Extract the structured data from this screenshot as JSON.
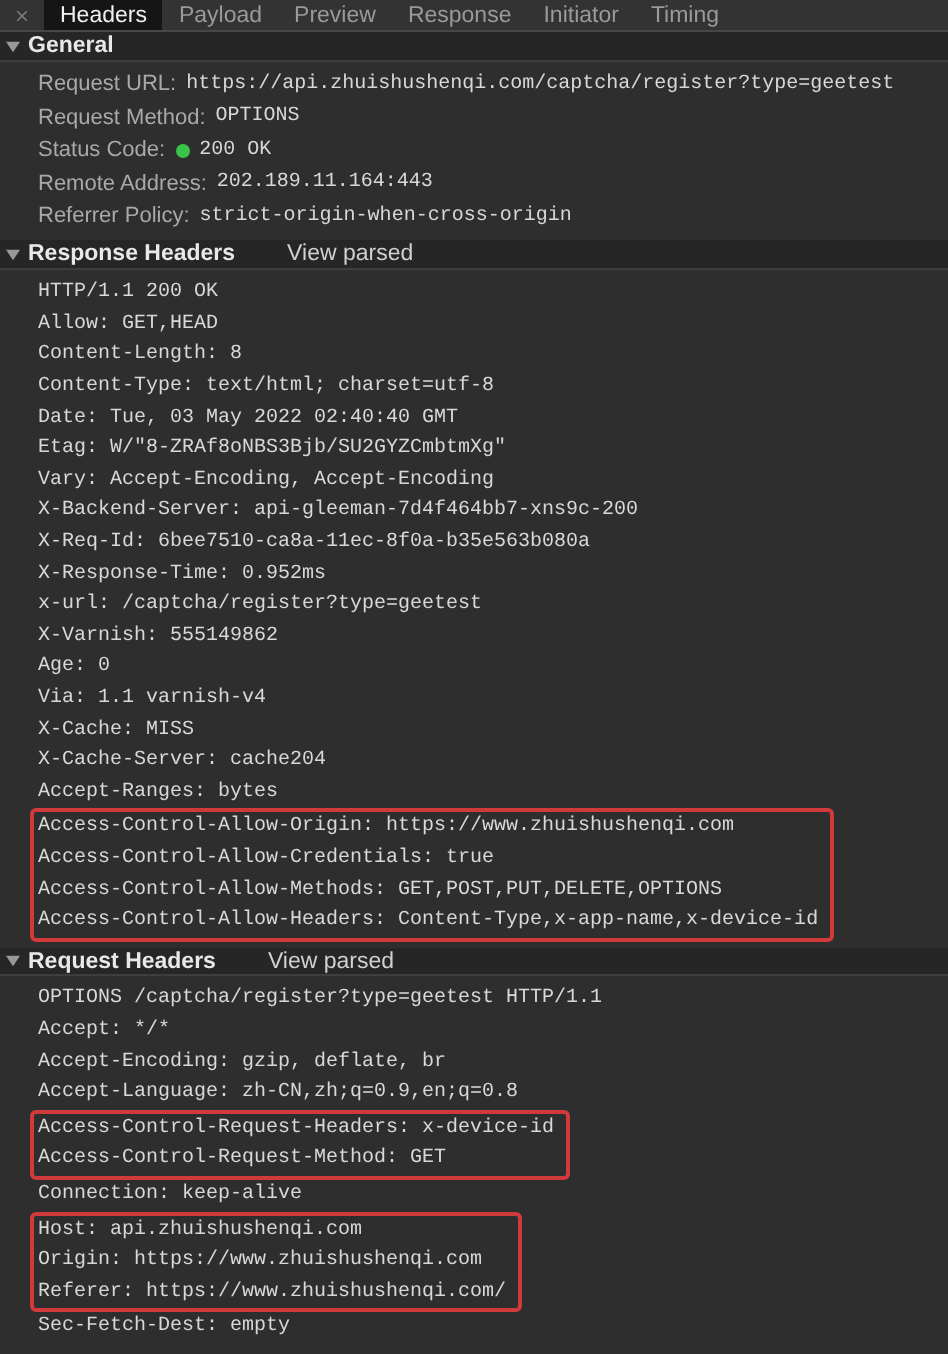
{
  "close_glyph": "×",
  "tabs": [
    {
      "label": "Headers",
      "selected": true
    },
    {
      "label": "Payload",
      "selected": false
    },
    {
      "label": "Preview",
      "selected": false
    },
    {
      "label": "Response",
      "selected": false
    },
    {
      "label": "Initiator",
      "selected": false
    },
    {
      "label": "Timing",
      "selected": false
    }
  ],
  "general": {
    "title": "General",
    "expanded": true,
    "rows": [
      {
        "label": "Request URL:",
        "value": "https://api.zhuishushenqi.com/captcha/register?type=geetest"
      },
      {
        "label": "Request Method:",
        "value": "OPTIONS"
      },
      {
        "label": "Status Code:",
        "value": "200 OK",
        "color": "#3cc34a"
      },
      {
        "label": "Remote Address:",
        "value": "202.189.11.164:443"
      },
      {
        "label": "Referrer Policy:",
        "value": "strict-origin-when-cross-origin"
      }
    ]
  },
  "header_sections": [
    {
      "title": "Response Headers",
      "link": "View parsed",
      "expanded": true,
      "groups": [
        {
          "highlighted": false,
          "lines": [
            "HTTP/1.1 200 OK",
            "Allow: GET,HEAD",
            "Content-Length: 8",
            "Content-Type: text/html; charset=utf-8",
            "Date: Tue, 03 May 2022 02:40:40 GMT",
            "Etag: W/\"8-ZRAf8oNBS3Bjb/SU2GYZCmbtmXg\"",
            "Vary: Accept-Encoding, Accept-Encoding",
            "X-Backend-Server: api-gleeman-7d4f464bb7-xns9c-200",
            "X-Req-Id: 6bee7510-ca8a-11ec-8f0a-b35e563b080a",
            "X-Response-Time: 0.952ms",
            "x-url: /captcha/register?type=geetest",
            "X-Varnish: 555149862",
            "Age: 0",
            "Via: 1.1 varnish-v4",
            "X-Cache: MISS",
            "X-Cache-Server: cache204",
            "Accept-Ranges: bytes"
          ]
        },
        {
          "highlighted": true,
          "lines": [
            "Access-Control-Allow-Origin: https://www.zhuishushenqi.com",
            "Access-Control-Allow-Credentials: true",
            "Access-Control-Allow-Methods: GET,POST,PUT,DELETE,OPTIONS",
            "Access-Control-Allow-Headers: Content-Type,x-app-name,x-device-id"
          ]
        }
      ]
    },
    {
      "title": "Request Headers",
      "link": "View parsed",
      "expanded": true,
      "groups": [
        {
          "highlighted": false,
          "lines": [
            "OPTIONS /captcha/register?type=geetest HTTP/1.1",
            "Accept: */*",
            "Accept-Encoding: gzip, deflate, br",
            "Accept-Language: zh-CN,zh;q=0.9,en;q=0.8"
          ]
        },
        {
          "highlighted": true,
          "lines": [
            "Access-Control-Request-Headers: x-device-id",
            "Access-Control-Request-Method: GET"
          ]
        },
        {
          "highlighted": false,
          "lines": [
            "Connection: keep-alive"
          ]
        },
        {
          "highlighted": true,
          "lines": [
            "Host: api.zhuishushenqi.com",
            "Origin: https://www.zhuishushenqi.com",
            "Referer: https://www.zhuishushenqi.com/"
          ]
        },
        {
          "highlighted": false,
          "lines": [
            "Sec-Fetch-Dest: empty"
          ]
        }
      ]
    }
  ]
}
